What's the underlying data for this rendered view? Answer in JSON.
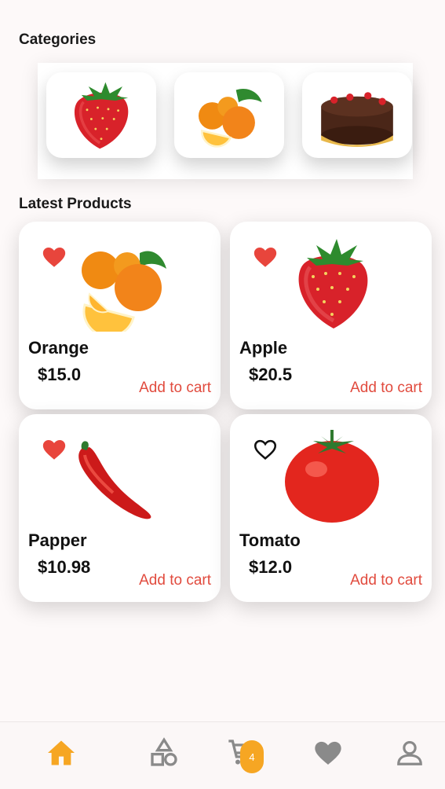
{
  "sections": {
    "categories_title": "Categories",
    "latest_title": "Latest Products"
  },
  "categories": [
    {
      "name": "strawberry",
      "icon": "strawberry-icon"
    },
    {
      "name": "orange",
      "icon": "orange-icon"
    },
    {
      "name": "cake",
      "icon": "chocolate-cake-icon"
    }
  ],
  "products": [
    {
      "name": "Orange",
      "price": "$15.0",
      "action": "Add to cart",
      "favorite": true,
      "image": "orange-image"
    },
    {
      "name": "Apple",
      "price": "$20.5",
      "action": "Add to cart",
      "favorite": true,
      "image": "strawberry-image"
    },
    {
      "name": "Papper",
      "price": "$10.98",
      "action": "Add to cart",
      "favorite": true,
      "image": "red-pepper-image"
    },
    {
      "name": "Tomato",
      "price": "$12.0",
      "action": "Add to cart",
      "favorite": false,
      "image": "tomato-image"
    }
  ],
  "nav": {
    "items": [
      "home-icon",
      "categories-icon",
      "cart-icon",
      "favorites-icon",
      "profile-icon"
    ],
    "active": "home-icon",
    "cart_badge": "4"
  },
  "colors": {
    "accent": "#f6a623",
    "heart": "#e8453c",
    "add_to_cart": "#e14b3e",
    "inactive_icon": "#8a8a8a"
  }
}
